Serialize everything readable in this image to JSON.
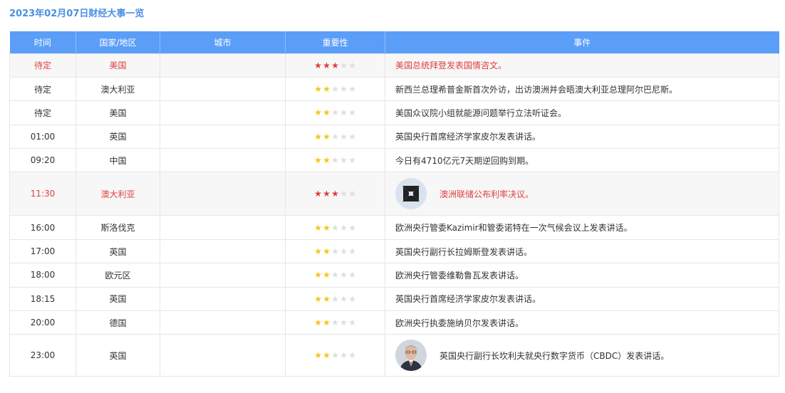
{
  "page": {
    "title": "2023年02月07日财经大事一览"
  },
  "table": {
    "headers": [
      "时间",
      "国家/地区",
      "城市",
      "重要性",
      "事件"
    ],
    "rows": [
      {
        "time": "待定",
        "country": "美国",
        "city": "",
        "stars": 3,
        "event": "美国总统拜登发表国情咨文。",
        "important": true,
        "avatar": null
      },
      {
        "time": "待定",
        "country": "澳大利亚",
        "city": "",
        "stars": 2,
        "event": "新西兰总理希普金斯首次外访，出访澳洲并会晤澳大利亚总理阿尔巴尼斯。",
        "important": false,
        "avatar": null
      },
      {
        "time": "待定",
        "country": "美国",
        "city": "",
        "stars": 2,
        "event": "美国众议院小组就能源问题举行立法听证会。",
        "important": false,
        "avatar": null
      },
      {
        "time": "01:00",
        "country": "英国",
        "city": "",
        "stars": 2,
        "event": "英国央行首席经济学家皮尔发表讲话。",
        "important": false,
        "avatar": null
      },
      {
        "time": "09:20",
        "country": "中国",
        "city": "",
        "stars": 2,
        "event": "今日有4710亿元7天期逆回购到期。",
        "important": false,
        "avatar": null
      },
      {
        "time": "11:30",
        "country": "澳大利亚",
        "city": "",
        "stars": 3,
        "event": "澳洲联储公布利率决议。",
        "important": true,
        "avatar": "rba-logo-icon"
      },
      {
        "time": "16:00",
        "country": "斯洛伐克",
        "city": "",
        "stars": 2,
        "event": "欧洲央行管委Kazimir和管委诺特在一次气候会议上发表讲话。",
        "important": false,
        "avatar": null
      },
      {
        "time": "17:00",
        "country": "英国",
        "city": "",
        "stars": 2,
        "event": "英国央行副行长拉姆斯登发表讲话。",
        "important": false,
        "avatar": null
      },
      {
        "time": "18:00",
        "country": "欧元区",
        "city": "",
        "stars": 2,
        "event": "欧洲央行管委维勒鲁瓦发表讲话。",
        "important": false,
        "avatar": null
      },
      {
        "time": "18:15",
        "country": "英国",
        "city": "",
        "stars": 2,
        "event": "英国央行首席经济学家皮尔发表讲话。",
        "important": false,
        "avatar": null
      },
      {
        "time": "20:00",
        "country": "德国",
        "city": "",
        "stars": 2,
        "event": "欧洲央行执委施纳贝尔发表讲话。",
        "important": false,
        "avatar": null
      },
      {
        "time": "23:00",
        "country": "英国",
        "city": "",
        "stars": 2,
        "event": "英国央行副行长坎利夫就央行数字货币（CBDC）发表讲话。",
        "important": false,
        "avatar": "speaker-photo-icon"
      }
    ],
    "max_stars": 5
  },
  "colors": {
    "header_bg": "#5b9ef8",
    "title": "#4a90e2",
    "important_text": "#e04040",
    "star_red": "#e03c3c",
    "star_gold": "#f5c518",
    "star_empty": "#dedede"
  }
}
